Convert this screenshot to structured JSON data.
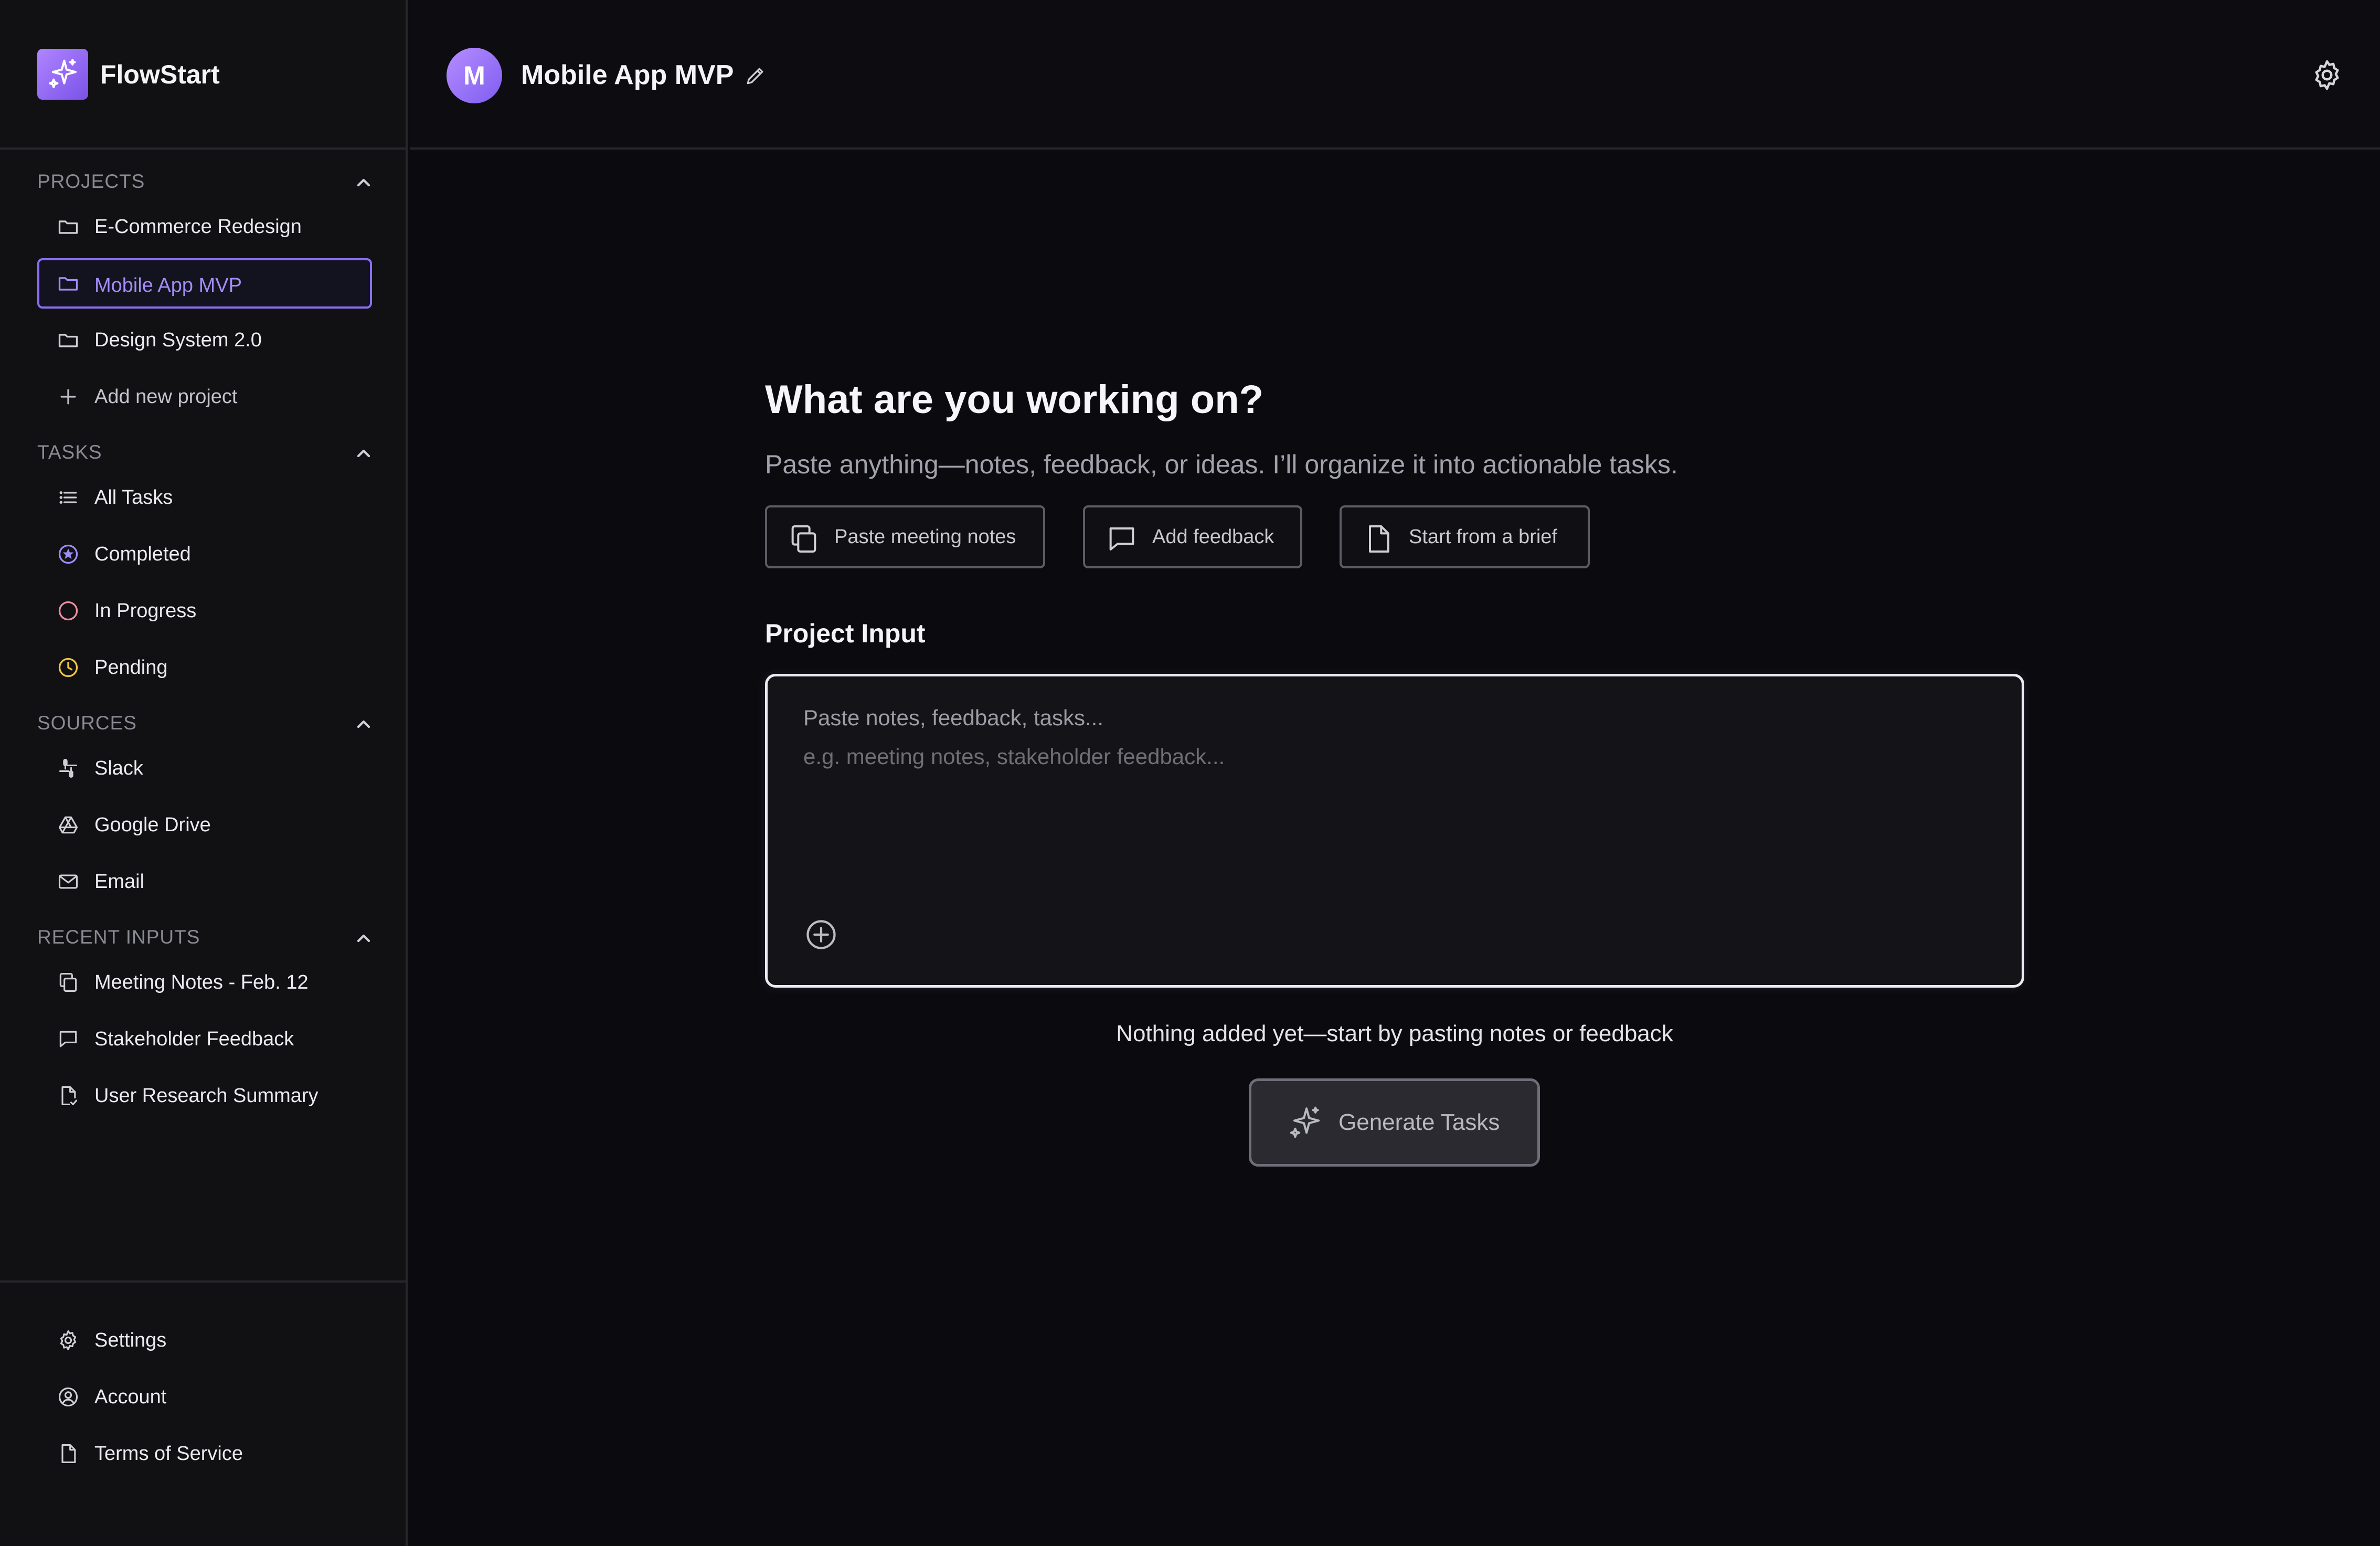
{
  "app": {
    "name": "FlowStart"
  },
  "colors": {
    "accent": "#8b6ff0",
    "background": "#0b0b0f",
    "sidebar": "#111114"
  },
  "header": {
    "avatar_letter": "M",
    "project_title": "Mobile App MVP"
  },
  "sidebar": {
    "projects": {
      "title": "PROJECTS",
      "items": [
        {
          "label": "E-Commerce Redesign",
          "icon": "folder-icon"
        },
        {
          "label": "Mobile App MVP",
          "icon": "folder-icon",
          "active": true
        },
        {
          "label": "Design System 2.0",
          "icon": "folder-icon"
        }
      ],
      "add_label": "Add new project"
    },
    "tasks": {
      "title": "TASKS",
      "items": [
        {
          "label": "All Tasks",
          "icon": "list-icon"
        },
        {
          "label": "Completed",
          "icon": "star-circle-icon"
        },
        {
          "label": "In Progress",
          "icon": "circle-icon"
        },
        {
          "label": "Pending",
          "icon": "clock-icon"
        }
      ]
    },
    "sources": {
      "title": "SOURCES",
      "items": [
        {
          "label": "Slack",
          "icon": "slack-icon"
        },
        {
          "label": "Google Drive",
          "icon": "drive-icon"
        },
        {
          "label": "Email",
          "icon": "mail-icon"
        }
      ]
    },
    "recent_inputs": {
      "title": "RECENT INPUTS",
      "items": [
        {
          "label": "Meeting Notes - Feb. 12",
          "icon": "copy-icon"
        },
        {
          "label": "Stakeholder Feedback",
          "icon": "message-icon"
        },
        {
          "label": "User Research Summary",
          "icon": "file-check-icon"
        }
      ]
    },
    "footer": {
      "items": [
        {
          "label": "Settings",
          "icon": "gear-icon"
        },
        {
          "label": "Account",
          "icon": "user-circle-icon"
        },
        {
          "label": "Terms of Service",
          "icon": "file-icon"
        }
      ]
    }
  },
  "main": {
    "title": "What are you working on?",
    "subtitle": "Paste anything—notes, feedback, or ideas. I’ll organize it into actionable tasks.",
    "quick_actions": [
      {
        "label": "Paste meeting notes",
        "icon": "copy-icon"
      },
      {
        "label": "Add feedback",
        "icon": "message-icon"
      },
      {
        "label": "Start from a brief",
        "icon": "file-icon"
      }
    ],
    "input_label": "Project Input",
    "input_placeholder": "Paste notes, feedback, tasks...",
    "input_example": "e.g. meeting notes, stakeholder feedback...",
    "empty_note": "Nothing added yet—start by pasting notes or feedback",
    "generate_label": "Generate Tasks"
  }
}
